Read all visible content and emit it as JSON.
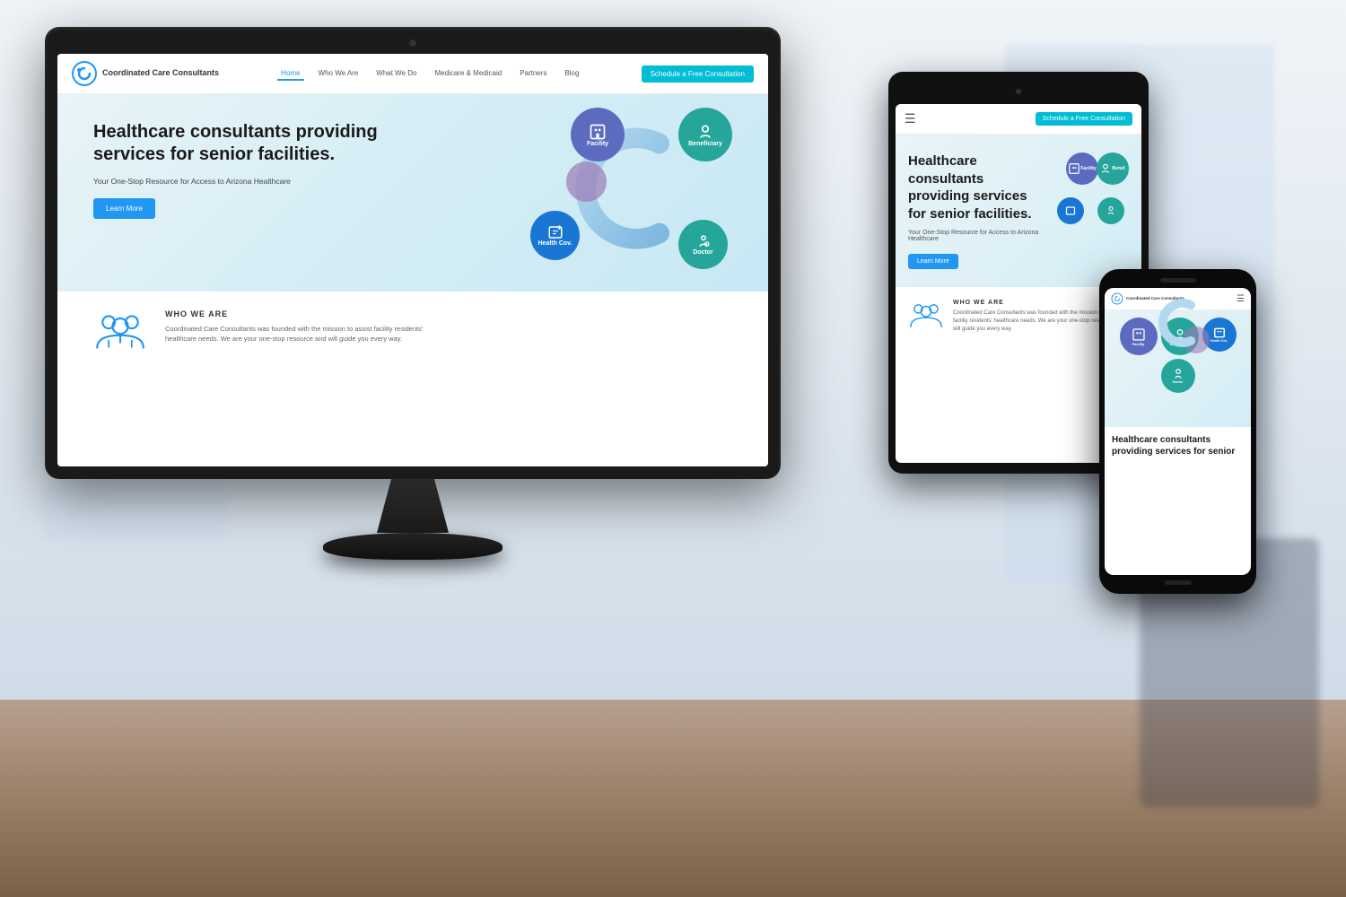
{
  "background": {
    "color": "#d8e0e8"
  },
  "monitor": {
    "website": {
      "nav": {
        "logo_name": "Coordinated Care Consultants",
        "links": [
          "Home",
          "Who We Are",
          "What We Do",
          "Medicare & Medicaid",
          "Partners",
          "Blog"
        ],
        "active_link": "Home",
        "cta_label": "Schedule a Free Consultation"
      },
      "hero": {
        "title": "Healthcare consultants providing services for senior facilities.",
        "subtitle": "Your One-Stop Resource for Access to Arizona Healthcare",
        "btn_label": "Learn More"
      },
      "graphic": {
        "bubbles": [
          {
            "label": "Facility",
            "color": "#5c6bc0"
          },
          {
            "label": "Beneficiary",
            "color": "#26a69a"
          },
          {
            "label": "Health Coverage",
            "color": "#1976d2"
          },
          {
            "label": "Doctor",
            "color": "#26a69a"
          }
        ]
      },
      "who_section": {
        "title": "WHO WE ARE",
        "text": "Coordinated Care Consultants was founded with the mission to assist facility residents' healthcare needs. We are your one-stop resource and will guide you every way."
      }
    }
  },
  "tablet": {
    "nav": {
      "cta_label": "Schedule a Free Consultation",
      "hamburger": "☰"
    },
    "hero": {
      "title": "Healthcare consultants providing services for senior facilities.",
      "subtitle": "Your One-Stop Resource for Access to Arizona Healthcare",
      "btn_label": "Learn More"
    },
    "who_section": {
      "title": "WHO WE ARE",
      "text": "Coordinated Care Consultants was founded with the mission to assist facility residents' healthcare needs. We are your one-stop resource and will guide you every way."
    }
  },
  "phone": {
    "nav": {
      "logo_name": "Coordinated Care Consultants",
      "hamburger": "☰"
    },
    "hero": {
      "title": "Healthcare consultants providing services for senior"
    }
  },
  "colors": {
    "primary_blue": "#2196F3",
    "teal": "#00BCD4",
    "purple": "#5c6bc0",
    "green": "#26a69a",
    "dark_blue": "#1976d2"
  }
}
